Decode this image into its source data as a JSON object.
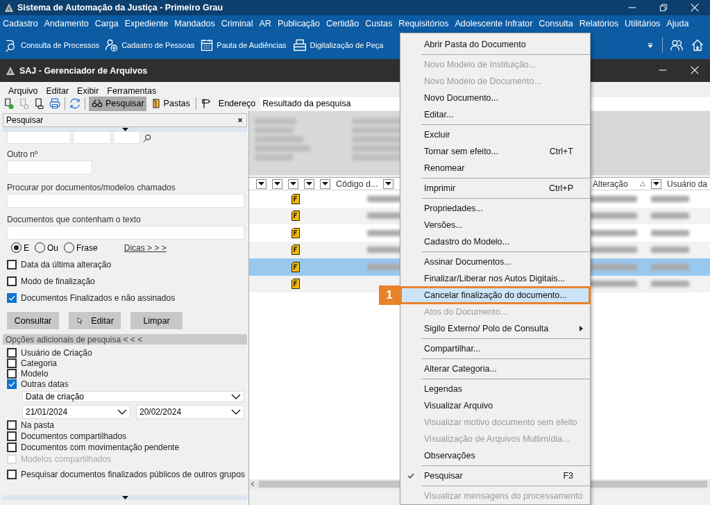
{
  "app_window": {
    "title": "Sistema de Automação da Justiça - Primeiro Grau"
  },
  "main_menu": [
    "Cadastro",
    "Andamento",
    "Carga",
    "Expediente",
    "Mandados",
    "Criminal",
    "AR",
    "Publicação",
    "Certidão",
    "Custas",
    "Requisitórios",
    "Adolescente Infrator",
    "Consulta",
    "Relatórios",
    "Utilitários",
    "Ajuda"
  ],
  "quick_toolbar": [
    {
      "kind": "process",
      "label": "Consulta de Processos"
    },
    {
      "kind": "person",
      "label": "Cadastro de Pessoas"
    },
    {
      "kind": "calendar",
      "label": "Pauta de Audiências"
    },
    {
      "kind": "scanner",
      "label": "Digitalização de Peça"
    }
  ],
  "inner_window": {
    "title": "SAJ - Gerenciador de Arquivos"
  },
  "inner_menu": [
    "Arquivo",
    "Editar",
    "Exibir",
    "Ferramentas"
  ],
  "toolbar": {
    "search_button": {
      "label": "Pesquisar",
      "selected": true
    },
    "folders_button": {
      "label": "Pastas",
      "selected": false
    },
    "address_label": "Endereço",
    "address_value": "Resultado da pesquisa"
  },
  "search_panel": {
    "title": "Pesquisar",
    "other_number_label": "Outro nº",
    "name_label": "Procurar por documentos/modelos chamados",
    "text_label": "Documentos que contenham o texto",
    "modes": [
      {
        "label": "E",
        "selected": true
      },
      {
        "label": "Ou",
        "selected": false
      },
      {
        "label": "Frase",
        "selected": false
      }
    ],
    "tips_link": "Dicas > > >",
    "checks": [
      {
        "label": "Data da última alteração",
        "checked": false
      },
      {
        "label": "Modo de finalização",
        "checked": false
      },
      {
        "label": "Documentos Finalizados e não assinados",
        "checked": true
      }
    ],
    "buttons": [
      "Consultar",
      "Editar",
      "Limpar"
    ],
    "more_options_title": "Opções adicionais de pesquisa < < <",
    "more_options": [
      {
        "kind": "checkbox",
        "label": "Usuário de Criação",
        "checked": false,
        "disabled": false
      },
      {
        "kind": "checkbox",
        "label": "Categoria",
        "checked": false,
        "disabled": false
      },
      {
        "kind": "checkbox",
        "label": "Modelo",
        "checked": false,
        "disabled": false
      },
      {
        "kind": "checkbox",
        "label": "Outras datas",
        "checked": true,
        "disabled": false
      },
      {
        "kind": "date_filter",
        "type": "Data de criação",
        "from": "21/01/2024",
        "to": "20/02/2024"
      },
      {
        "kind": "checkbox",
        "label": "Na pasta",
        "checked": false,
        "disabled": false
      },
      {
        "kind": "checkbox",
        "label": "Documentos compartilhados",
        "checked": false,
        "disabled": false
      },
      {
        "kind": "checkbox",
        "label": "Documentos com movimentação pendente",
        "checked": false,
        "disabled": false
      },
      {
        "kind": "checkbox",
        "label": "Modelos compartilhados",
        "checked": false,
        "disabled": true
      },
      {
        "kind": "checkbox",
        "label": "Pesquisar documentos finalizados públicos de outros grupos",
        "checked": false,
        "disabled": false
      }
    ]
  },
  "results": {
    "code_column": "Código d...",
    "date_column": "Alteração",
    "user_column": "Usuário da",
    "rows": [
      {
        "selected": false
      },
      {
        "selected": false
      },
      {
        "selected": false
      },
      {
        "selected": false
      },
      {
        "selected": true
      },
      {
        "selected": false
      }
    ]
  },
  "context_menu": [
    {
      "kind": "item",
      "label": "Abrir Pasta do Documento",
      "disabled": false
    },
    {
      "kind": "separator"
    },
    {
      "kind": "item",
      "label": "Novo Modelo de Instituição...",
      "disabled": true
    },
    {
      "kind": "item",
      "label": "Novo Modelo de Documento...",
      "disabled": true
    },
    {
      "kind": "item",
      "label": "Novo Documento...",
      "disabled": false
    },
    {
      "kind": "item",
      "label": "Editar...",
      "disabled": false
    },
    {
      "kind": "separator"
    },
    {
      "kind": "item",
      "label": "Excluir",
      "disabled": false
    },
    {
      "kind": "item",
      "label": "Tornar sem efeito...",
      "shortcut": "Ctrl+T",
      "disabled": false
    },
    {
      "kind": "item",
      "label": "Renomear",
      "disabled": false
    },
    {
      "kind": "separator"
    },
    {
      "kind": "item",
      "label": "Imprimir",
      "shortcut": "Ctrl+P",
      "disabled": false
    },
    {
      "kind": "separator"
    },
    {
      "kind": "item",
      "label": "Propriedades...",
      "disabled": false
    },
    {
      "kind": "item",
      "label": "Versões...",
      "disabled": false
    },
    {
      "kind": "item",
      "label": "Cadastro do Modelo...",
      "disabled": false
    },
    {
      "kind": "separator"
    },
    {
      "kind": "item",
      "label": "Assinar Documentos...",
      "disabled": false
    },
    {
      "kind": "item",
      "label": "Finalizar/Liberar nos Autos Digitais...",
      "disabled": false
    },
    {
      "kind": "item",
      "label": "Cancelar finalização do documento...",
      "disabled": false,
      "highlighted": true,
      "callout": "1"
    },
    {
      "kind": "item",
      "label": "Atos do Documento...",
      "disabled": true
    },
    {
      "kind": "item",
      "label": "Sigilo Externo/ Polo de Consulta",
      "disabled": false,
      "submenu": true
    },
    {
      "kind": "separator"
    },
    {
      "kind": "item",
      "label": "Compartilhar...",
      "disabled": false
    },
    {
      "kind": "separator"
    },
    {
      "kind": "item",
      "label": "Alterar Categoria...",
      "disabled": false
    },
    {
      "kind": "separator"
    },
    {
      "kind": "item",
      "label": "Legendas",
      "disabled": false
    },
    {
      "kind": "item",
      "label": "Visualizar Arquivo",
      "disabled": false
    },
    {
      "kind": "item",
      "label": "Visualizar motivo documento sem efeito",
      "disabled": true
    },
    {
      "kind": "item",
      "label": "Visualização de Arquivos Multimídia...",
      "disabled": true
    },
    {
      "kind": "item",
      "label": "Observações",
      "disabled": false
    },
    {
      "kind": "separator"
    },
    {
      "kind": "item",
      "label": "Pesquisar",
      "shortcut": "F3",
      "disabled": false,
      "checked": true
    },
    {
      "kind": "separator"
    },
    {
      "kind": "item",
      "label": "Visualizar mensagens do processamento",
      "disabled": true
    }
  ]
}
